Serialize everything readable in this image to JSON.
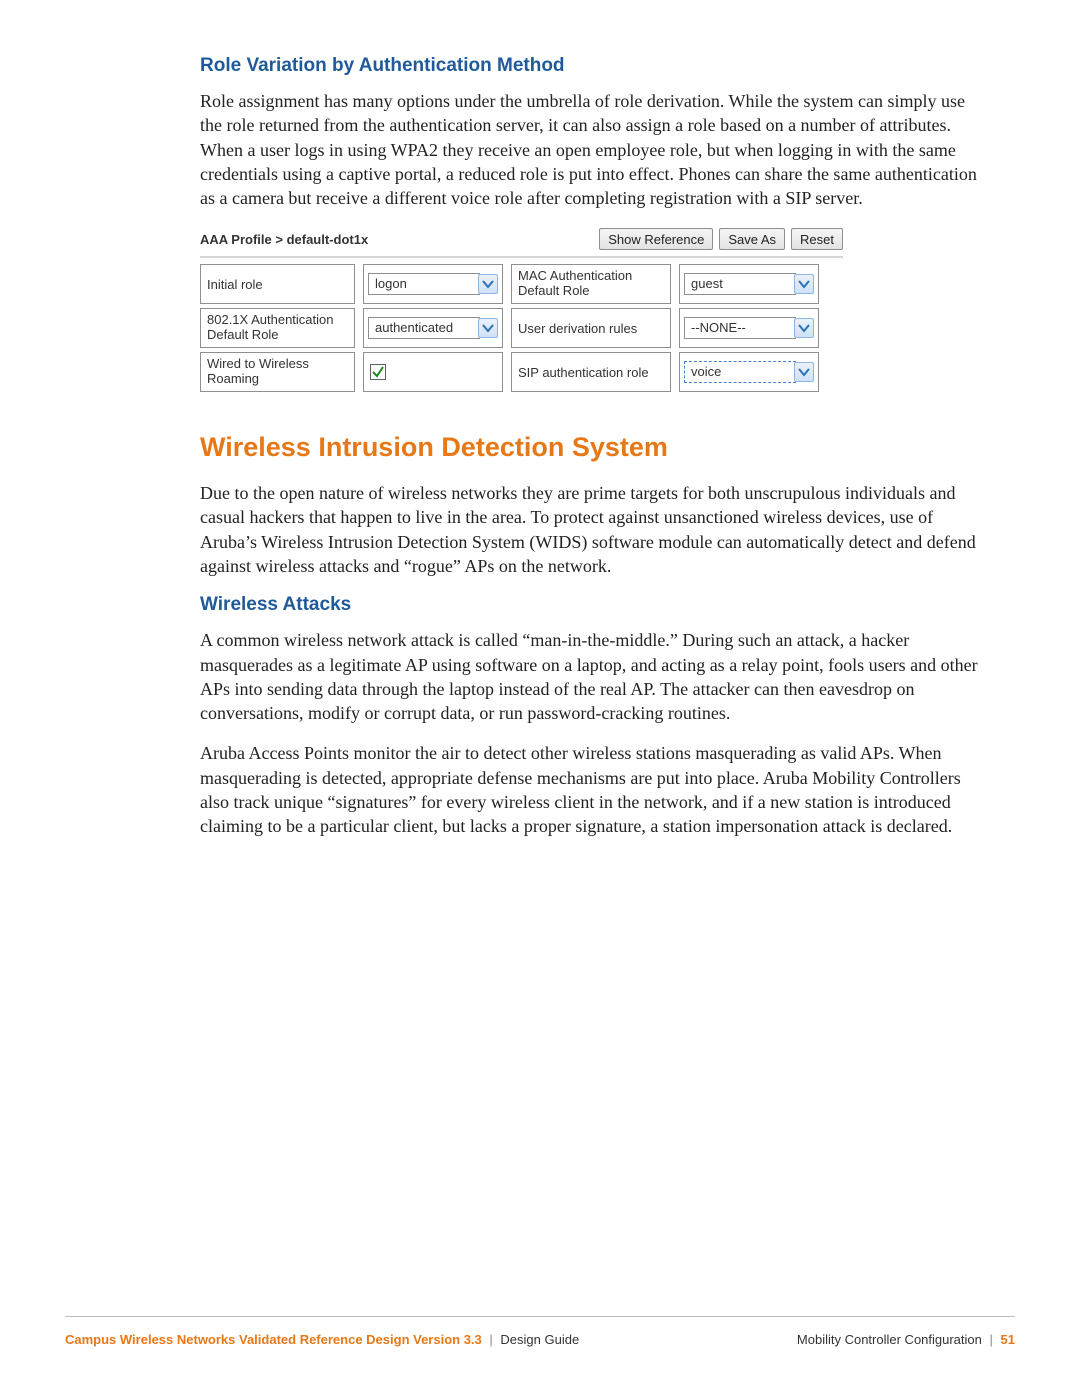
{
  "section1": {
    "heading": "Role Variation by Authentication Method",
    "paragraph": "Role assignment has many options under the umbrella of role derivation. While the system can simply use the role returned from the authentication server, it can also assign a role based on a number of attributes. When a user logs in using WPA2 they receive an open employee role, but when logging in with the same credentials using a captive portal, a reduced role is put into effect. Phones can share the same authentication as a camera but receive a different voice role after completing registration with a SIP server."
  },
  "panel": {
    "title": "AAA Profile > default-dot1x",
    "buttons": {
      "show_ref": "Show Reference",
      "save_as": "Save As",
      "reset": "Reset"
    },
    "rows": {
      "r1": {
        "label_left": "Initial role",
        "value_left": "logon",
        "label_right": "MAC Authentication Default Role",
        "value_right": "guest"
      },
      "r2": {
        "label_left": "802.1X Authentication Default Role",
        "value_left": "authenticated",
        "label_right": "User derivation rules",
        "value_right": "--NONE--"
      },
      "r3": {
        "label_left": "Wired to Wireless Roaming",
        "checked": true,
        "label_right": "SIP authentication role",
        "value_right": "voice"
      }
    }
  },
  "section2": {
    "heading": "Wireless Intrusion Detection System",
    "paragraph": "Due to the open nature of wireless networks they are prime targets for both unscrupulous individuals and casual hackers that happen to live in the area. To protect against unsanctioned wireless devices, use of Aruba’s Wireless Intrusion Detection System (WIDS) software module can automatically detect and defend against wireless attacks and “rogue” APs on the network."
  },
  "section3": {
    "heading": "Wireless Attacks",
    "paragraph1": "A common wireless network attack is called “man-in-the-middle.” During such an attack, a hacker masquerades as a legitimate AP using software on a laptop, and acting as a relay point, fools users and other APs into sending data through the laptop instead of the real AP. The attacker can then eavesdrop on conversations, modify or corrupt data, or run password-cracking routines.",
    "paragraph2": "Aruba Access Points monitor the air to detect other wireless stations masquerading as valid APs. When masquerading is detected, appropriate defense mechanisms are put into place. Aruba Mobility Controllers also track unique “signatures” for every wireless client in the network, and if a new station is introduced claiming to be a particular client, but lacks a proper signature, a station impersonation attack is declared."
  },
  "footer": {
    "left_bold": "Campus Wireless Networks Validated Reference Design Version 3.3",
    "left_plain": "Design Guide",
    "right_plain": "Mobility Controller Configuration",
    "page": "51"
  }
}
